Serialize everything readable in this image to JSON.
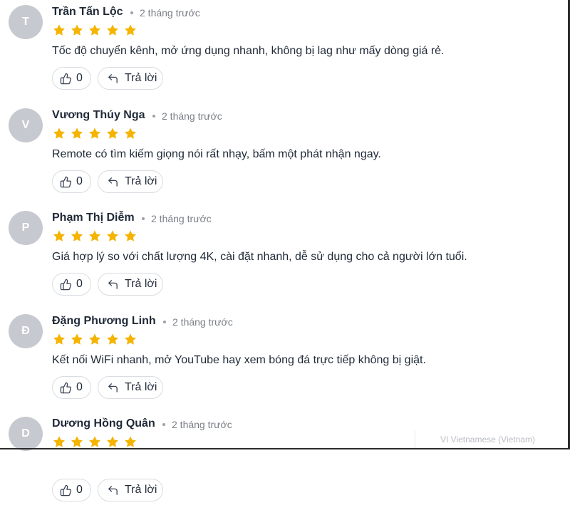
{
  "colors": {
    "star": "#f4b400",
    "avatar_bg": "#c6c9cf",
    "text": "#1f2937",
    "meta": "#7b7f86"
  },
  "reviews": [
    {
      "initial": "T",
      "name": "Trần Tấn Lộc",
      "time": "2 tháng trước",
      "rating": 5,
      "text": "Tốc độ chuyển kênh, mở ứng dụng nhanh, không bị lag như mấy dòng giá rẻ.",
      "likes": "0",
      "reply_label": "Trả lời"
    },
    {
      "initial": "V",
      "name": "Vương Thúy Nga",
      "time": "2 tháng trước",
      "rating": 5,
      "text": "Remote có tìm kiếm giọng nói rất nhạy, bấm một phát nhận ngay.",
      "likes": "0",
      "reply_label": "Trả lời"
    },
    {
      "initial": "P",
      "name": "Phạm Thị Diễm",
      "time": "2 tháng trước",
      "rating": 5,
      "text": "Giá hợp lý so với chất lượng 4K, cài đặt nhanh, dễ sử dụng cho cả người lớn tuổi.",
      "likes": "0",
      "reply_label": "Trả lời"
    },
    {
      "initial": "Đ",
      "name": "Đặng Phương Linh",
      "time": "2 tháng trước",
      "rating": 5,
      "text": "Kết nối WiFi nhanh, mở YouTube hay xem bóng đá trực tiếp không bị giật.",
      "likes": "0",
      "reply_label": "Trả lời"
    },
    {
      "initial": "D",
      "name": "Dương Hồng Quân",
      "time": "2 tháng trước",
      "rating": 5,
      "text": "",
      "likes": "0",
      "reply_label": "Trả lời"
    }
  ],
  "language_indicator": "VI  Vietnamese (Vietnam)"
}
